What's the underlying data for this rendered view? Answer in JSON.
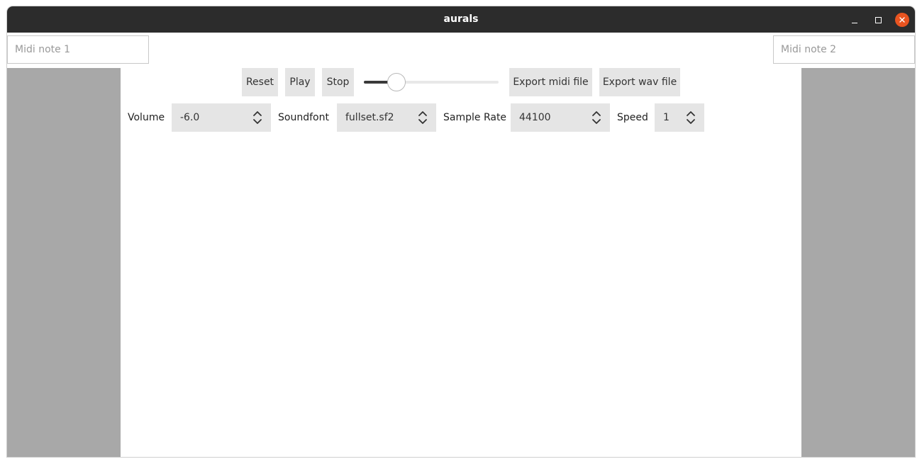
{
  "window": {
    "title": "aurals"
  },
  "midi": {
    "note1_placeholder": "Midi note 1",
    "note1_value": "",
    "note2_placeholder": "Midi note 2",
    "note2_value": ""
  },
  "toolbar": {
    "reset_label": "Reset",
    "play_label": "Play",
    "stop_label": "Stop",
    "export_midi_label": "Export midi file",
    "export_wav_label": "Export wav file"
  },
  "slider": {
    "value_fraction": 0.24
  },
  "settings": {
    "volume_label": "Volume",
    "volume_value": "-6.0",
    "soundfont_label": "Soundfont",
    "soundfont_value": "fullset.sf2",
    "sample_rate_label": "Sample Rate",
    "sample_rate_value": "44100",
    "speed_label": "Speed",
    "speed_value": "1"
  },
  "colors": {
    "titlebar": "#2c2c2c",
    "close_button": "#e95420",
    "side_panel": "#a8a8a8",
    "button_bg": "#e5e5e5"
  },
  "icons": {
    "minimize": "minimize-icon",
    "maximize": "maximize-icon",
    "close": "close-icon",
    "spin_arrows": "up-down-chevron-icon"
  }
}
